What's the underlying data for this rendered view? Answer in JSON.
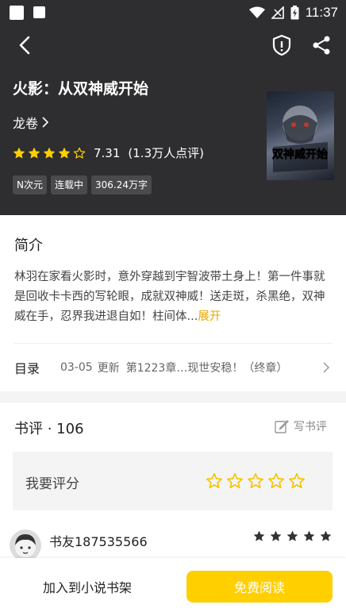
{
  "status_bar": {
    "time": "11:37"
  },
  "book": {
    "title": "火影：从双神威开始",
    "author": "龙卷",
    "rating_score": "7.31",
    "rating_count": "(1.3万人点评)",
    "stars_filled": 4,
    "stars_total": 5,
    "tags": [
      "N次元",
      "连载中",
      "306.24万字"
    ],
    "cover_title": "双神威开始"
  },
  "intro": {
    "heading": "简介",
    "text": "林羽在家看火影时，意外穿越到宇智波带土身上！第一件事就是回收卡卡西的写轮眼，成就双神威！送走斑，杀黑绝，双神威在手，忍界我进退自如！柱间体...",
    "expand_label": "展开"
  },
  "toc": {
    "label": "目录",
    "date": "03-05",
    "update_label": "更新",
    "latest_chapter": "第1223章…现世安稳！（终章）"
  },
  "reviews": {
    "heading": "书评 · 106",
    "write_label": "写书评",
    "rate_label": "我要评分",
    "rate_stars": 5
  },
  "comment": {
    "username": "书友187535566",
    "stars": 5
  },
  "actions": {
    "add_shelf": "加入到小说书架",
    "free_read": "免费阅读"
  },
  "colors": {
    "header_bg": "#2e2e30",
    "accent": "#ffcf00",
    "expand_link": "#e4a800"
  }
}
